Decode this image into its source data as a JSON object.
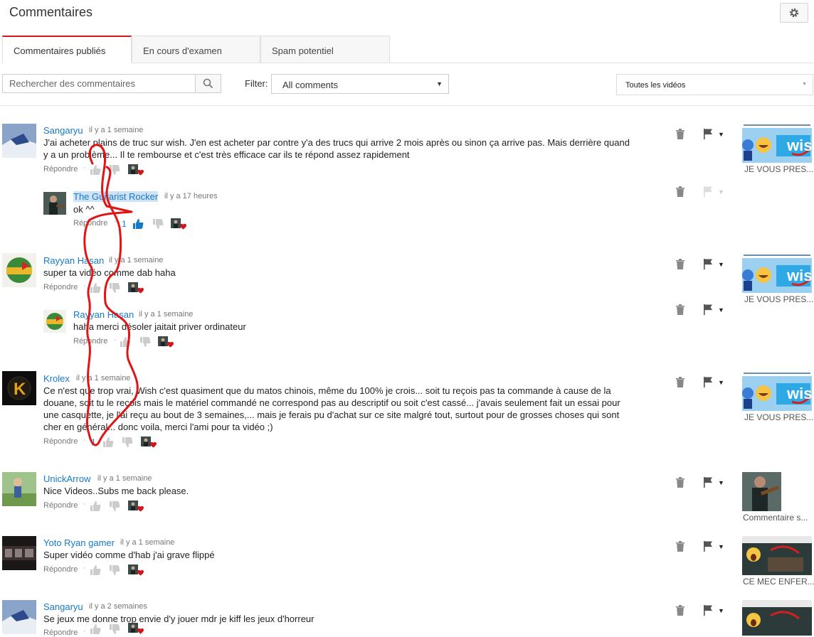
{
  "header": {
    "title": "Commentaires",
    "settings_icon": "gear-icon"
  },
  "tabs": [
    {
      "label": "Commentaires publiés",
      "active": true
    },
    {
      "label": "En cours d'examen",
      "active": false
    },
    {
      "label": "Spam potentiel",
      "active": false
    }
  ],
  "toolbar": {
    "search_placeholder": "Rechercher des commentaires",
    "filter_label": "Filter:",
    "filter_value": "All comments",
    "videos_value": "Toutes les vidéos"
  },
  "comments": [
    {
      "author": "Sangaryu",
      "time": "il y a 1 semaine",
      "text": "J'ai acheter plains de truc sur wish. J'en est acheter par contre y'a des trucs qui arrive 2 mois après ou sinon ça arrive pas. Mais derrière quand y a un problème... Il te rembourse et c'est très efficace car ils te répond assez rapidement",
      "reply": "Répondre",
      "video_caption": "JE VOUS PRES..."
    },
    {
      "author": "The Guitarist Rocker",
      "time": "il y a 17 heures",
      "text": "ok ^^",
      "reply": "Répondre",
      "likes": "1"
    },
    {
      "author": "Rayyan Hasan",
      "time": "il y a 1 semaine",
      "text": "super ta vidéo comme dab haha",
      "reply": "Répondre",
      "video_caption": "JE VOUS PRES..."
    },
    {
      "author": "Rayyan Hasan",
      "time": "il y a 1 semaine",
      "text": "haha merci désoler  jaitait priver ordinateur",
      "reply": "Répondre"
    },
    {
      "author": "Krolex",
      "time": "il y a 1 semaine",
      "text": "Ce n'est que trop vrai, Wish c'est quasiment que du matos chinois, même du 100% je crois... soit tu reçois pas ta commande à cause de la douane, soit tu le reçois mais le matériel commandé ne correspond pas au descriptif ou soit c'est cassé... j'avais seulement fait un essai pour une casquette, je l'ai reçu au bout de 3 semaines,... mais je ferais pu d'achat sur ce site malgré tout, surtout pour de grosses choses qui sont cher en général... donc voila, merci l'ami pour ta vidéo ;)",
      "reply": "Répondre",
      "likes": "1",
      "video_caption": "JE VOUS PRES..."
    },
    {
      "author": "UnickArrow",
      "time": "il y a 1 semaine",
      "text": "Nice Videos..Subs me back please.",
      "reply": "Répondre",
      "video_caption": "Commentaire s..."
    },
    {
      "author": "Yoto Ryan gamer",
      "time": "il y a 1 semaine",
      "text": "Super vidéo comme d'hab j'ai grave flippé",
      "reply": "Répondre",
      "video_caption": "CE MEC ENFER..."
    },
    {
      "author": "Sangaryu",
      "time": "il y a 2 semaines",
      "text": "Se jeux me donne trop envie d'y jouer mdr je kiff les jeux d'horreur",
      "reply": "Répondre"
    }
  ],
  "thumbnails": {
    "wish_text": "wish",
    "avatar_k": "K"
  }
}
